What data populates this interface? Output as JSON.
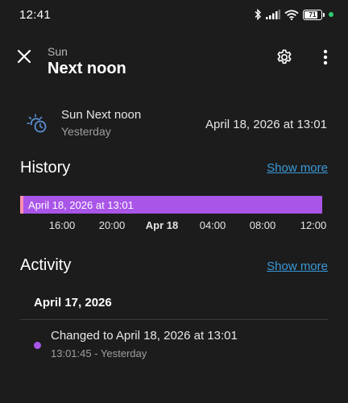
{
  "status_bar": {
    "time": "12:41",
    "battery": "71",
    "icons": [
      "bluetooth-icon",
      "signal-icon",
      "wifi-icon",
      "battery-icon",
      "notification-dot"
    ]
  },
  "header": {
    "domain": "Sun",
    "title": "Next noon",
    "icons": [
      "close-icon",
      "gear-icon",
      "more-vertical-icon"
    ]
  },
  "entity": {
    "name": "Sun Next noon",
    "last_changed": "Yesterday",
    "state": "April 18, 2026 at 13:01",
    "icon": "sun-clock-icon"
  },
  "history": {
    "title": "History",
    "show_more": "Show more",
    "bar_label": "April 18, 2026 at 13:01",
    "axis_labels": [
      "16:00",
      "20:00",
      "Apr 18",
      "04:00",
      "08:00",
      "12:00"
    ],
    "bar_color": "#a855e8"
  },
  "activity": {
    "title": "Activity",
    "show_more": "Show more",
    "date": "April 17, 2026",
    "entries": [
      {
        "text": "Changed to April 18, 2026 at 13:01",
        "meta": "13:01:45 - Yesterday"
      }
    ]
  },
  "colors": {
    "background": "#1c1c1c",
    "accent": "#3a9ad9",
    "timeline": "#a855e8"
  }
}
